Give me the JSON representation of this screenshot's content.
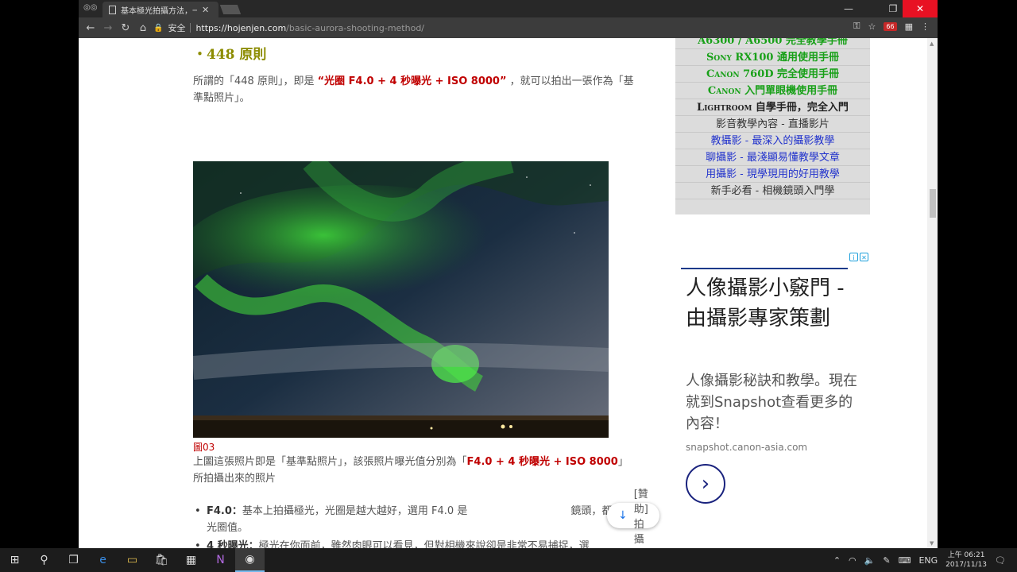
{
  "browser": {
    "tab_title": "基本極光拍攝方法，一",
    "security_label": "安全",
    "url_host": "https://hojenjen.com",
    "url_path": "/basic-aurora-shooting-method/",
    "extension_badge": "66"
  },
  "article": {
    "heading": "・448 原則",
    "para1_before": "所謂的「448 原則」，即是 ",
    "para1_highlight": "“光圈 F4.0 + 4 秒曝光 + ISO 8000”",
    "para1_after": " ，就可以拍出一張作為「基準點照片」。",
    "caption": "圖03",
    "para2_before": "上圖這張照片即是「基準點照片」，該張照片曝光值分別為「",
    "para2_highlight": "F4.0 + 4 秒曝光 + ISO 8000",
    "para2_after": "」所拍攝出來的照片",
    "bullets": [
      {
        "term": "F4.0：",
        "text": "基本上拍攝極光，光圈是越大越好，選用 F4.0 是　　　　　　　　　　鏡頭，都有這光圈值。"
      },
      {
        "term": "4 秒曝光：",
        "text": "極光在你面前，雖然肉眼可以看見，但對相機來說卻是非常不易捕捉，選"
      }
    ],
    "sponsor_label": "[贊助] 拍攝"
  },
  "sidebar_menu": [
    {
      "label": "A6300 / A6500 完全教學手冊",
      "style": "green"
    },
    {
      "label": "Sony RX100 通用使用手冊",
      "style": "green"
    },
    {
      "label": "Canon 760D 完全使用手冊",
      "style": "green"
    },
    {
      "label": "Canon 入門單眼機使用手冊",
      "style": "green"
    },
    {
      "label": "Lightroom 自學手冊，完全入門",
      "style": "dark"
    },
    {
      "label": "影音教學內容 - 直播影片",
      "style": "plain"
    },
    {
      "label": "教攝影 - 最深入的攝影教學",
      "style": "blue"
    },
    {
      "label": "聊攝影 - 最淺顯易懂教學文章",
      "style": "blue"
    },
    {
      "label": "用攝影 - 現學現用的好用教學",
      "style": "blue"
    },
    {
      "label": "新手必看 - 相機鏡頭入門學",
      "style": "plain"
    }
  ],
  "ad": {
    "title": "人像攝影小竅門 - 由攝影專家策劃",
    "description": "人像攝影秘訣和教學。現在就到Snapshot查看更多的內容！",
    "domain": "snapshot.canon-asia.com"
  },
  "taskbar": {
    "language": "ENG",
    "time": "上午 06:21",
    "date": "2017/11/13"
  }
}
